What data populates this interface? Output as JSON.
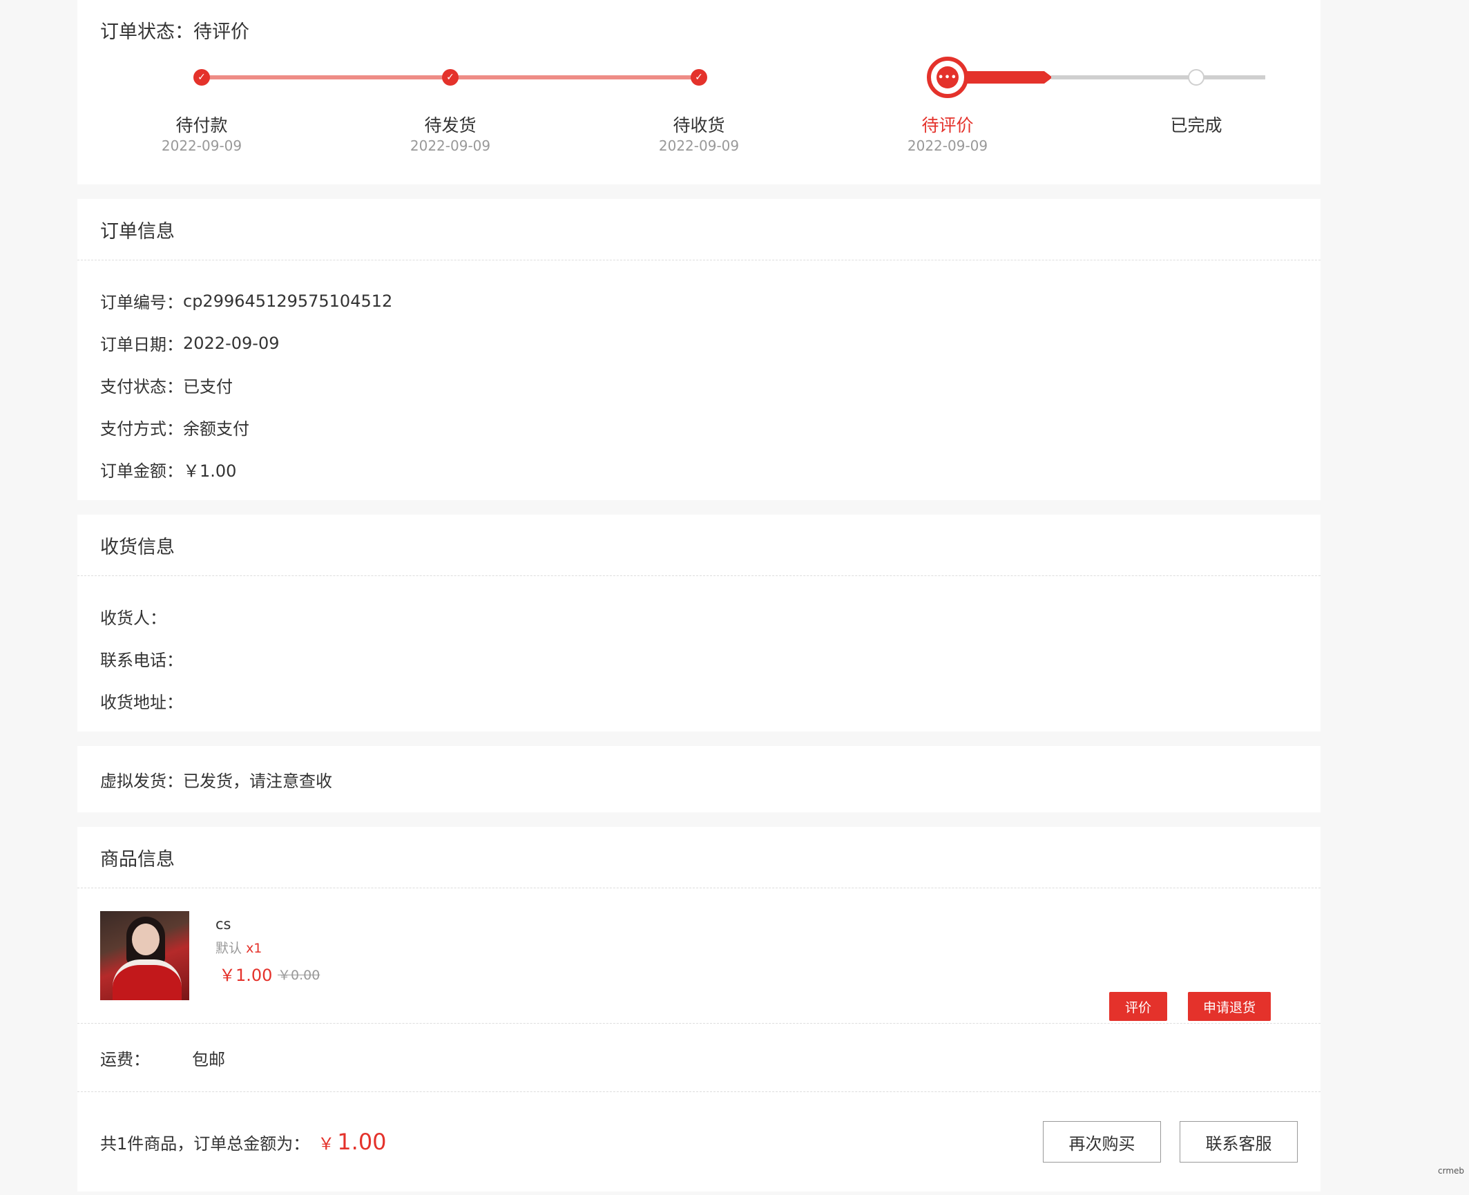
{
  "status": {
    "title_label": "订单状态：",
    "title_value": "待评价",
    "steps": [
      {
        "label": "待付款",
        "date": "2022-09-09",
        "state": "done"
      },
      {
        "label": "待发货",
        "date": "2022-09-09",
        "state": "done"
      },
      {
        "label": "待收货",
        "date": "2022-09-09",
        "state": "done"
      },
      {
        "label": "待评价",
        "date": "2022-09-09",
        "state": "current"
      },
      {
        "label": "已完成",
        "date": "",
        "state": "pending"
      }
    ]
  },
  "order_info": {
    "heading": "订单信息",
    "order_no_label": "订单编号：",
    "order_no": "cp299645129575104512",
    "date_label": "订单日期：",
    "date": "2022-09-09",
    "pay_status_label": "支付状态：",
    "pay_status": "已支付",
    "pay_method_label": "支付方式：",
    "pay_method": "余额支付",
    "amount_label": "订单金额：",
    "amount": "￥1.00"
  },
  "delivery": {
    "heading": "收货信息",
    "receiver_label": "收货人：",
    "receiver": "",
    "phone_label": "联系电话：",
    "phone": "",
    "address_label": "收货地址：",
    "address": ""
  },
  "virtual": {
    "label": "虚拟发货：",
    "value": "已发货，请注意查收"
  },
  "goods": {
    "heading": "商品信息",
    "item": {
      "name": "cs",
      "spec": "默认",
      "qty": "x1",
      "price": "￥1.00",
      "orig_price": "￥0.00",
      "review_label": "评价",
      "refund_label": "申请退货"
    },
    "shipping_label": "运费：",
    "shipping_value": "包邮",
    "total_label": "共1件商品，订单总金额为：",
    "total_yen": "￥",
    "total_amount": "1.00",
    "rebuy_label": "再次购买",
    "service_label": "联系客服"
  },
  "watermark": "crmeb",
  "colors": {
    "accent": "#e4322b",
    "progress_done": "#ee8c86",
    "progress_pending": "#cfcfcf"
  }
}
